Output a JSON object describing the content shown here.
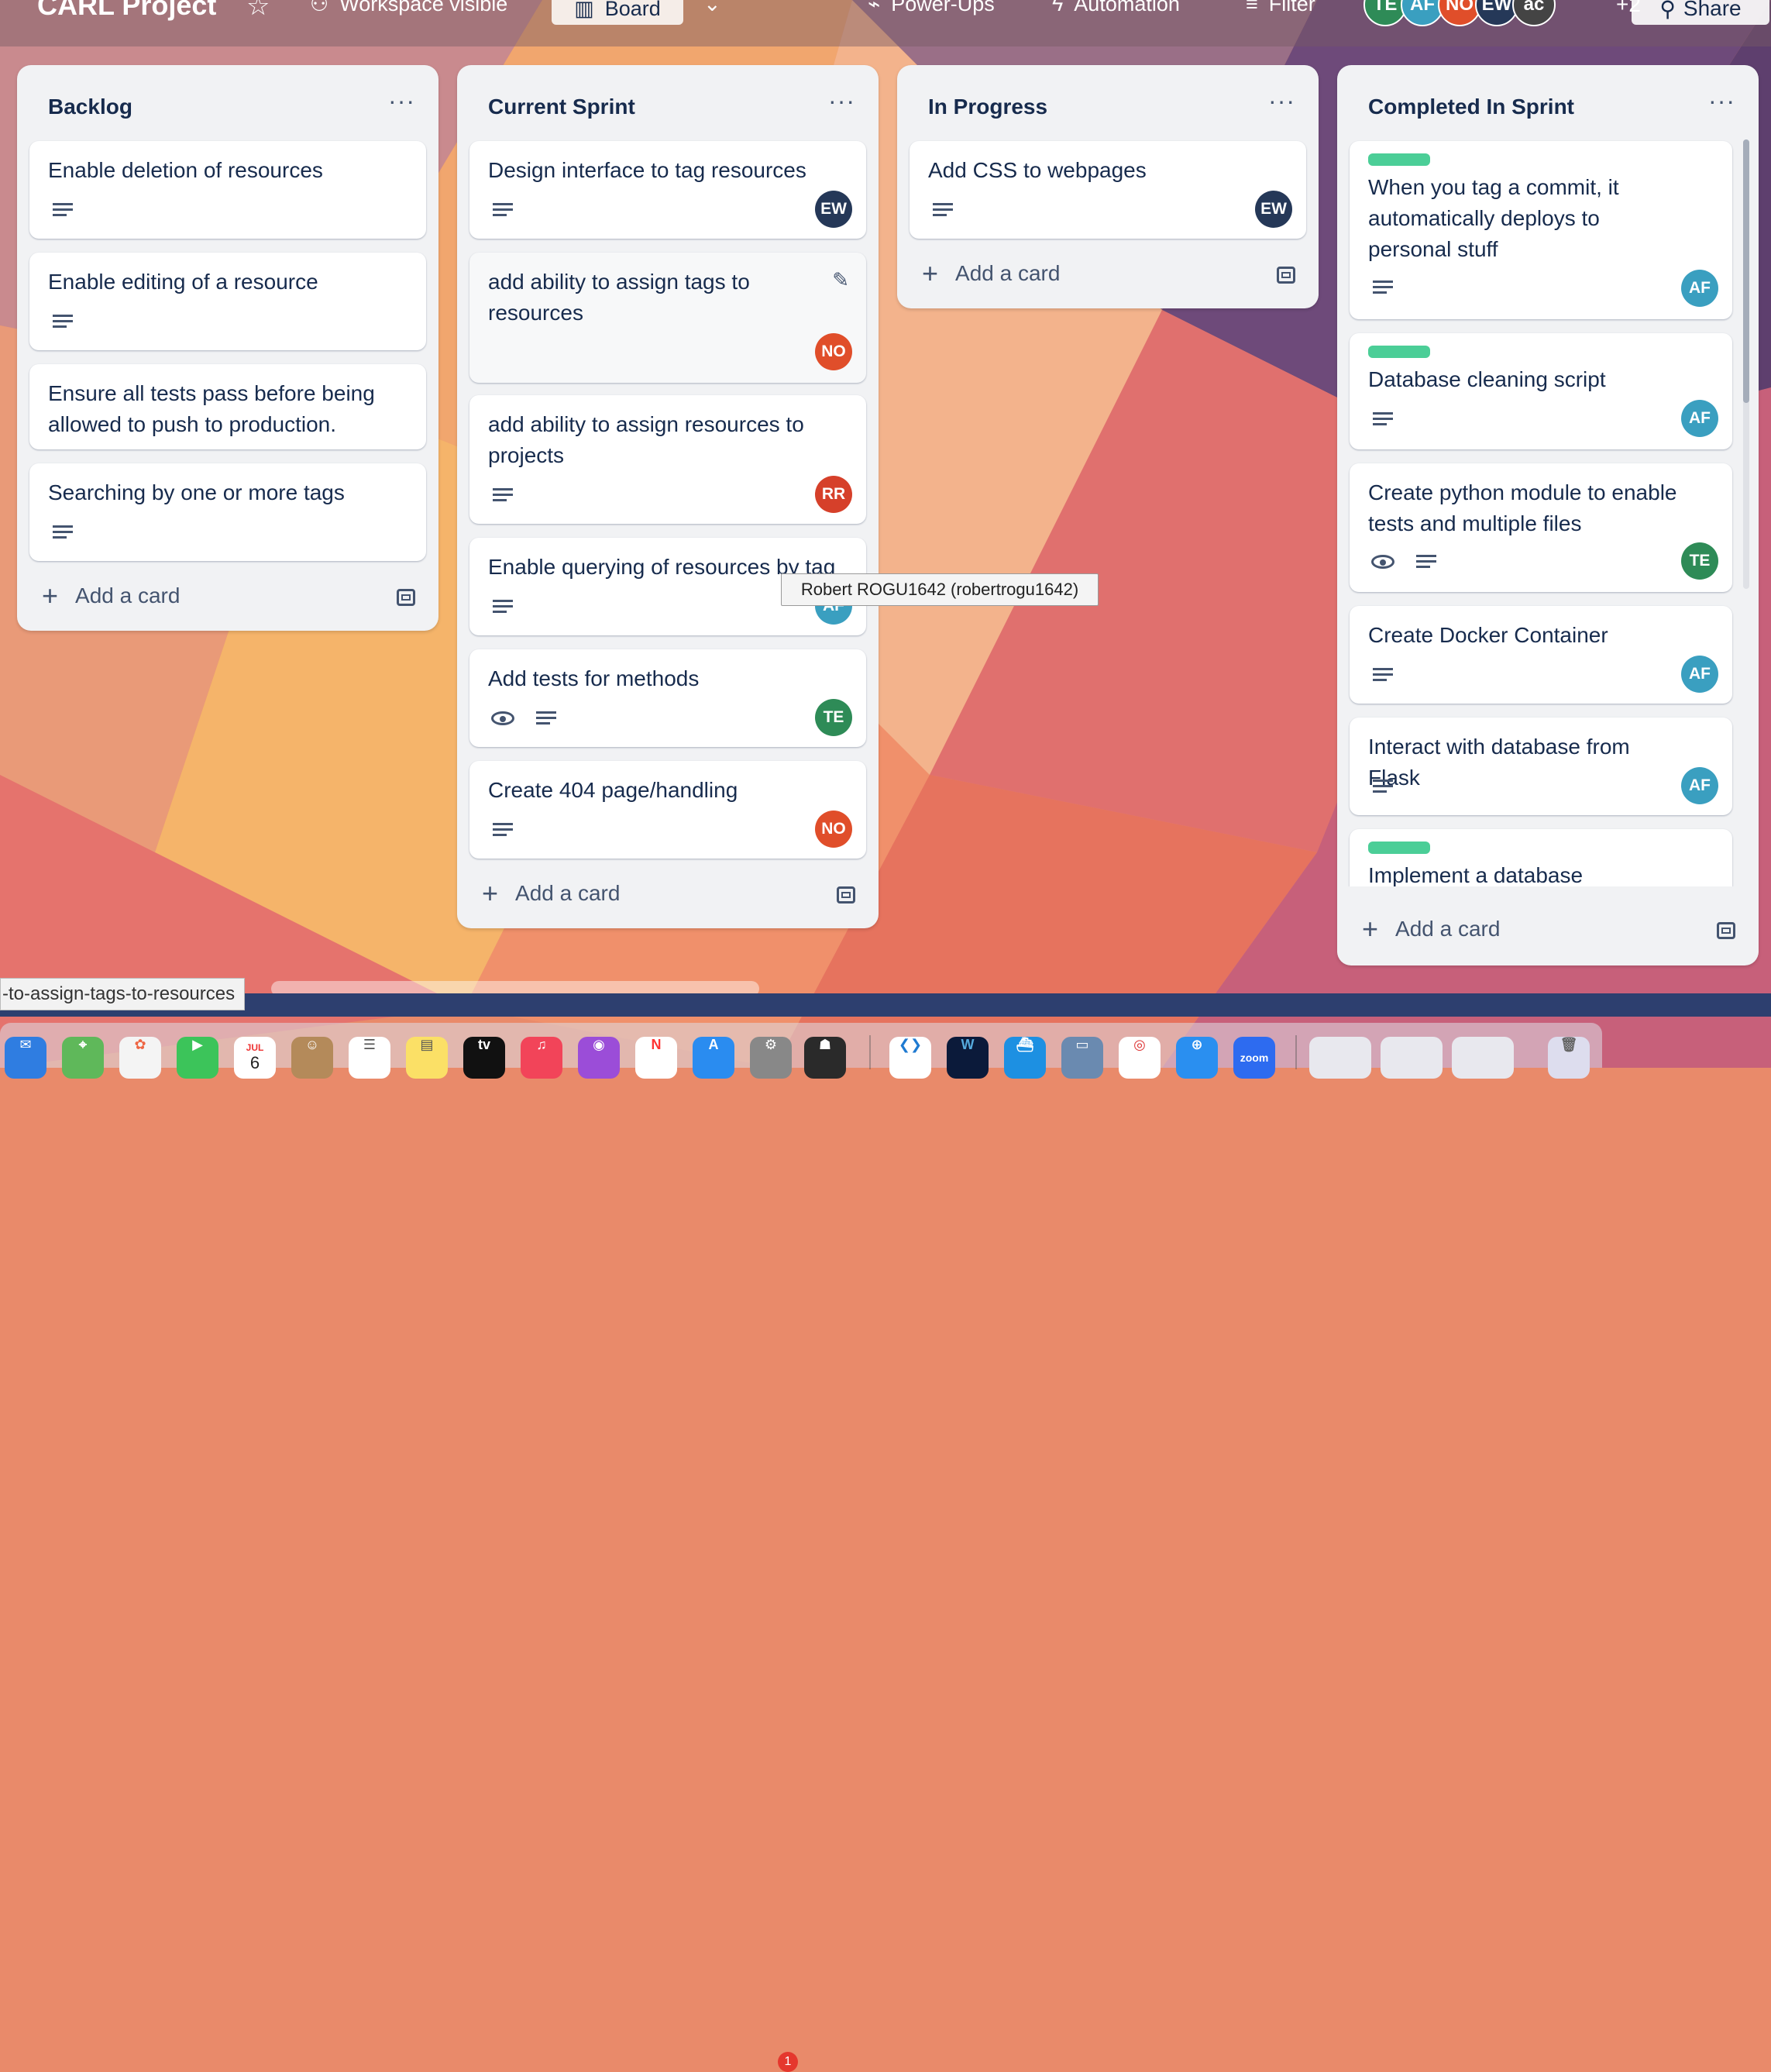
{
  "header": {
    "board_title": "CARL Project",
    "visibility": "Workspace visible",
    "view": "Board",
    "power_ups": "Power-Ups",
    "automation": "Automation",
    "filter": "Filter",
    "members": [
      {
        "initials": "TE",
        "color": "#2e8b57"
      },
      {
        "initials": "AF",
        "color": "#3a9fc0"
      },
      {
        "initials": "NO",
        "color": "#e04e2a"
      },
      {
        "initials": "EW",
        "color": "#253858"
      },
      {
        "initials": "ac",
        "color": "#444"
      }
    ],
    "more_members": "+2",
    "share": "Share"
  },
  "lists": [
    {
      "title": "Backlog",
      "cards": [
        {
          "title": "Enable deletion of resources"
        },
        {
          "title": "Enable editing of a resource"
        },
        {
          "title": "Ensure all tests pass before being allowed to push to production."
        },
        {
          "title": "Searching by one or more tags"
        }
      ],
      "add_card": "Add a card"
    },
    {
      "title": "Current Sprint",
      "cards": [
        {
          "title": "Design interface to tag resources",
          "member": "EW"
        },
        {
          "title": "add ability to assign tags to resources",
          "member": "NO"
        },
        {
          "title": "add ability to assign resources to projects",
          "member": "RR"
        },
        {
          "title": "Enable querying of resources by tag",
          "member": "AF"
        },
        {
          "title": "Add tests for methods",
          "member": "TE"
        },
        {
          "title": "Create 404 page/handling",
          "member": "NO"
        }
      ],
      "add_card": "Add a card"
    },
    {
      "title": "In Progress",
      "cards": [
        {
          "title": "Add CSS to webpages",
          "member": "EW"
        }
      ],
      "add_card": "Add a card"
    },
    {
      "title": "Completed In Sprint",
      "cards": [
        {
          "title": "When you tag a commit, it automatically deploys to personal stuff",
          "member": "AF"
        },
        {
          "title": "Database cleaning script",
          "member": "AF"
        },
        {
          "title": "Create python module to enable tests and multiple files",
          "member": "TE"
        },
        {
          "title": "Create Docker Container",
          "member": "AF"
        },
        {
          "title": "Interact with database from Flask",
          "member": "AF"
        },
        {
          "title": "Implement a database"
        }
      ],
      "add_card": "Add a card"
    }
  ],
  "colors": {
    "EW": "#253858",
    "NO": "#e04e2a",
    "RR": "#d6402a",
    "AF": "#3a9fc0",
    "TE": "#2e8b57",
    "label_green": "#4bce97"
  },
  "tooltip": "Robert ROGU1642 (robertrogu1642)",
  "status_url": "-to-assign-tags-to-resources",
  "dock": {
    "calendar_month": "JUL",
    "calendar_day": "6",
    "tv_label": "tv",
    "zoom_label": "zoom",
    "settings_badge": "1"
  }
}
